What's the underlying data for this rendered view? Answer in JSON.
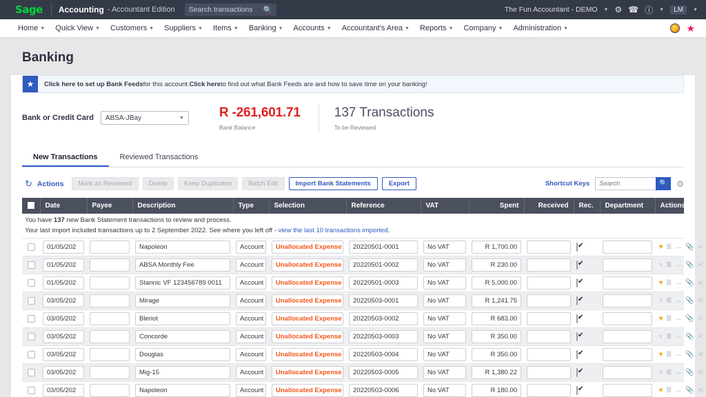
{
  "topbar": {
    "logo": "Sage",
    "app_title": "Accounting",
    "app_subtitle": "- Accountant Edition",
    "search_placeholder": "Search transactions",
    "search_value": "",
    "search_icon": "search-icon",
    "company": "The Fun Accountant - DEMO",
    "gear_icon": "gear-icon",
    "phone_icon": "phone-icon",
    "help_icon": "help-icon",
    "user_initials": "LM"
  },
  "nav": {
    "items": [
      {
        "label": "Home"
      },
      {
        "label": "Quick View"
      },
      {
        "label": "Customers"
      },
      {
        "label": "Suppliers"
      },
      {
        "label": "Items"
      },
      {
        "label": "Banking"
      },
      {
        "label": "Accounts"
      },
      {
        "label": "Accountant's Area"
      },
      {
        "label": "Reports"
      },
      {
        "label": "Company"
      },
      {
        "label": "Administration"
      }
    ],
    "badge_icon": "coin-badge-icon",
    "favorite_icon": "star-icon"
  },
  "page": {
    "title": "Banking"
  },
  "banner": {
    "icon": "star-icon",
    "link1": "Click here to set up Bank Feeds",
    "mid": " for this account. ",
    "link2": "Click here",
    "tail": " to find out what Bank Feeds are and how to save time on your banking!"
  },
  "account": {
    "label": "Bank or Credit Card",
    "selected": "ABSA-JBay",
    "balance": "R -261,601.71",
    "balance_caption": "Bank Balance",
    "transactions": "137 Transactions",
    "transactions_caption": "To be Reviewed"
  },
  "tabs": [
    {
      "label": "New Transactions",
      "active": true
    },
    {
      "label": "Reviewed Transactions",
      "active": false
    }
  ],
  "toolbar": {
    "refresh_icon": "refresh-icon",
    "actions_label": "Actions",
    "mark_reviewed": "Mark as Reviewed",
    "delete": "Delete",
    "keep_duplicates": "Keep Duplicates",
    "batch_edit": "Batch Edit",
    "import": "Import Bank Statements",
    "export": "Export",
    "shortcut_keys": "Shortcut Keys",
    "search_placeholder": "Search",
    "search_value": "",
    "search_icon": "search-icon",
    "settings_icon": "gear-icon"
  },
  "notice": {
    "line1_pre": "You have ",
    "line1_count": "137",
    "line1_post": " new Bank Statement transactions to review and process.",
    "line2_pre": "Your last import included transactions up to 2 September 2022. See where you left off - ",
    "line2_link": "view the last 10 transactions imported",
    "line2_post": "."
  },
  "table": {
    "columns": [
      "Date",
      "Payee",
      "Description",
      "Type",
      "Selection",
      "Reference",
      "VAT",
      "Spent",
      "Received",
      "Rec.",
      "Department",
      "Actions"
    ],
    "rows": [
      {
        "date": "01/05/202",
        "payee": "",
        "description": "Napoleon",
        "type": "Account",
        "selection": "Unallocated Expense",
        "reference": "20220501-0001",
        "vat": "No VAT",
        "spent": "R 1,700.00",
        "received": "",
        "rec": true,
        "department": ""
      },
      {
        "date": "01/05/202",
        "payee": "",
        "description": "ABSA Monthly Fee",
        "type": "Account",
        "selection": "Unallocated Expense",
        "reference": "20220501-0002",
        "vat": "No VAT",
        "spent": "R 230.00",
        "received": "",
        "rec": true,
        "department": ""
      },
      {
        "date": "01/05/202",
        "payee": "",
        "description": "Stannic VF 123456789 0011",
        "type": "Account",
        "selection": "Unallocated Expense",
        "reference": "20220501-0003",
        "vat": "No VAT",
        "spent": "R 5,000.00",
        "received": "",
        "rec": true,
        "department": ""
      },
      {
        "date": "03/05/202",
        "payee": "",
        "description": "Mirage",
        "type": "Account",
        "selection": "Unallocated Expense",
        "reference": "20220503-0001",
        "vat": "No VAT",
        "spent": "R 1,241.75",
        "received": "",
        "rec": true,
        "department": ""
      },
      {
        "date": "03/05/202",
        "payee": "",
        "description": "Bleriot",
        "type": "Account",
        "selection": "Unallocated Expense",
        "reference": "20220503-0002",
        "vat": "No VAT",
        "spent": "R 683.00",
        "received": "",
        "rec": true,
        "department": ""
      },
      {
        "date": "03/05/202",
        "payee": "",
        "description": "Concorde",
        "type": "Account",
        "selection": "Unallocated Expense",
        "reference": "20220503-0003",
        "vat": "No VAT",
        "spent": "R 350.00",
        "received": "",
        "rec": true,
        "department": ""
      },
      {
        "date": "03/05/202",
        "payee": "",
        "description": "Douglas",
        "type": "Account",
        "selection": "Unallocated Expense",
        "reference": "20220503-0004",
        "vat": "No VAT",
        "spent": "R 350.00",
        "received": "",
        "rec": true,
        "department": ""
      },
      {
        "date": "03/05/202",
        "payee": "",
        "description": "Mig-15",
        "type": "Account",
        "selection": "Unallocated Expense",
        "reference": "20220503-0005",
        "vat": "No VAT",
        "spent": "R 1,380.22",
        "received": "",
        "rec": true,
        "department": ""
      },
      {
        "date": "03/05/202",
        "payee": "",
        "description": "Napoleon",
        "type": "Account",
        "selection": "Unallocated Expense",
        "reference": "20220503-0006",
        "vat": "No VAT",
        "spent": "R 180.00",
        "received": "",
        "rec": true,
        "department": ""
      }
    ],
    "action_icons": [
      "chevron-down-icon",
      "list-icon",
      "arrows-horizontal-icon",
      "paperclip-icon",
      "split-icon",
      "plus-icon",
      "minus-icon"
    ]
  },
  "colors": {
    "header_bg": "#353a48",
    "sage_green": "#00d639",
    "accent_blue": "#3457bd",
    "balance_red": "#e02020",
    "selection_orange": "#f2571c",
    "plus_green": "#16b52b",
    "minus_red": "#e8184e"
  }
}
